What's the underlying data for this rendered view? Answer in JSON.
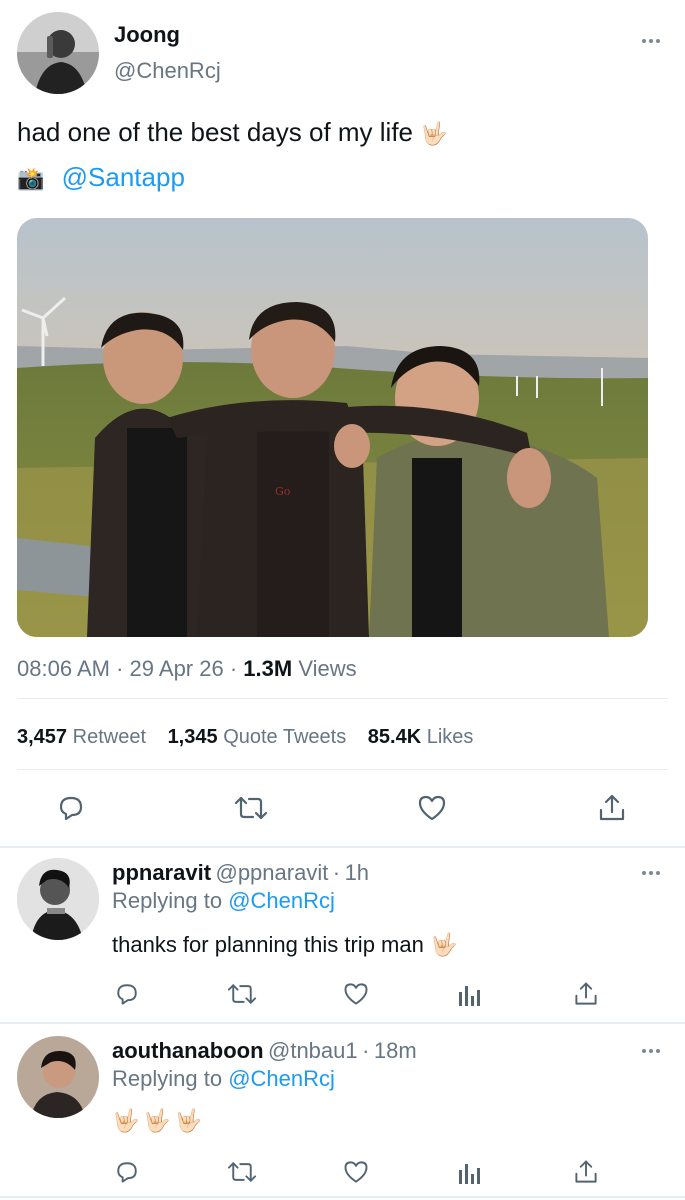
{
  "tweet": {
    "author": {
      "name": "Joong",
      "handle": "@ChenRcj"
    },
    "text": "had one of the best days of my life",
    "text_emoji": "🤟🏻",
    "camera_emoji": "📸",
    "mention": "@Santapp",
    "time": "08:06 AM",
    "date": "29 Apr 26",
    "views_count": "1.3M",
    "views_label": "Views",
    "retweets_count": "3,457",
    "retweets_label": "Retweet",
    "quotes_count": "1,345",
    "quotes_label": "Quote Tweets",
    "likes_count": "85.4K",
    "likes_label": "Likes"
  },
  "replies": [
    {
      "name": "ppnaravit",
      "handle": "@ppnaravit",
      "age": "1h",
      "replying_prefix": "Replying to",
      "replying_to": "@ChenRcj",
      "text": "thanks for planning this trip man",
      "emoji": "🤟🏻"
    },
    {
      "name": "aouthanaboon",
      "handle": "@tnbau1",
      "age": "18m",
      "replying_prefix": "Replying to",
      "replying_to": "@ChenRcj",
      "text": "",
      "emoji": "🤟🏻🤟🏻🤟🏻"
    }
  ],
  "separator": "·",
  "icons": {
    "reply": "reply-icon",
    "retweet": "retweet-icon",
    "like": "heart-icon",
    "share": "share-icon",
    "analytics": "analytics-icon",
    "more": "more-icon"
  },
  "colors": {
    "link": "#1d9bf0",
    "text": "#0f1419",
    "muted": "#687684",
    "divider": "#e6ecf0"
  }
}
